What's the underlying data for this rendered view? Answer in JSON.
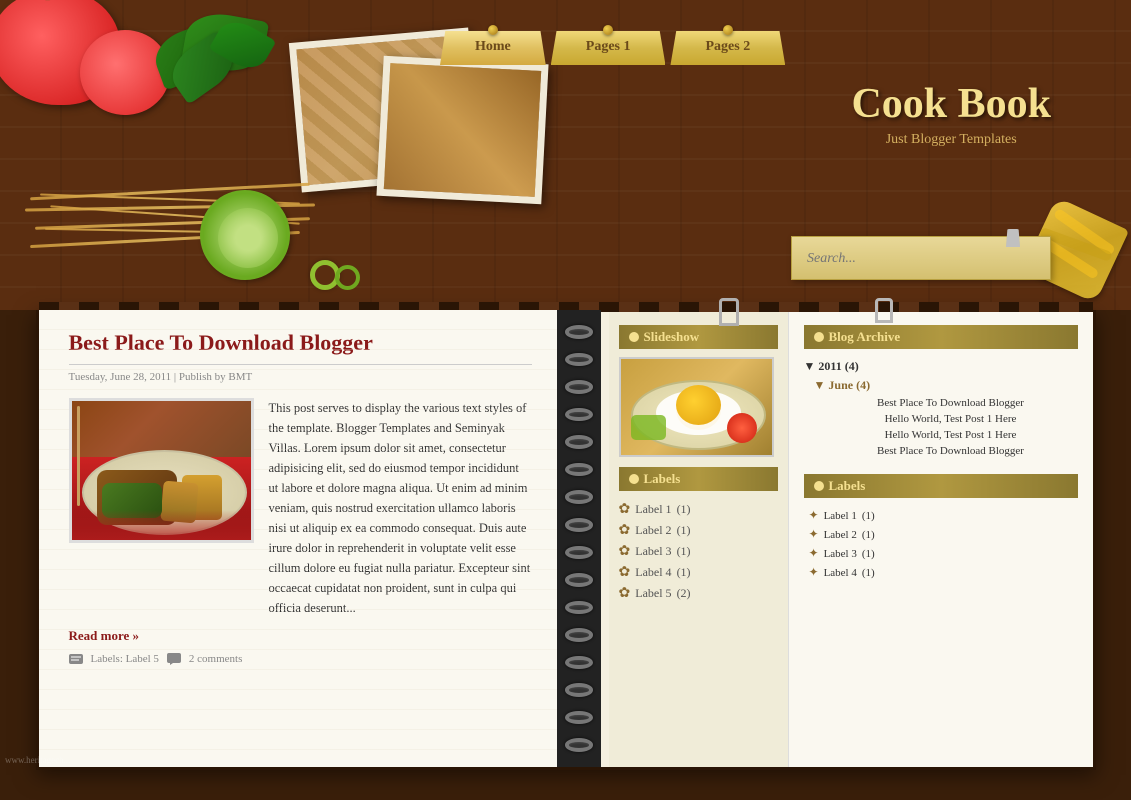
{
  "site": {
    "title": "Cook Book",
    "subtitle": "Just Blogger Templates",
    "watermark": "www.heritagech..."
  },
  "nav": {
    "tabs": [
      {
        "id": "home",
        "label": "Home",
        "active": true
      },
      {
        "id": "pages1",
        "label": "Pages 1",
        "active": false
      },
      {
        "id": "pages2",
        "label": "Pages 2",
        "active": false
      }
    ]
  },
  "search": {
    "placeholder": "Search..."
  },
  "post": {
    "title": "Best Place To Download Blogger",
    "meta": "Tuesday, June 28, 2011 | Publish by BMT",
    "body": "This post serves to display the various text styles of the template. Blogger Templates and Seminyak Villas. Lorem ipsum dolor sit amet, consectetur adipisicing elit, sed do eiusmod tempor incididunt ut labore et dolore magna aliqua. Ut enim ad minim veniam, quis nostrud exercitation ullamco laboris nisi ut aliquip ex ea commodo consequat. Duis aute irure dolor in reprehenderit in voluptate velit esse cillum dolore eu fugiat nulla pariatur. Excepteur sint occaecat cupidatat non proident, sunt in culpa qui officia deserunt...",
    "read_more": "Read more »",
    "footer_labels": "Labels: Label 5",
    "footer_comments": "2 comments"
  },
  "slideshow": {
    "title": "Slideshow"
  },
  "labels_middle": {
    "title": "Labels",
    "items": [
      {
        "name": "Label 1",
        "count": "(1)"
      },
      {
        "name": "Label 2",
        "count": "(1)"
      },
      {
        "name": "Label 3",
        "count": "(1)"
      },
      {
        "name": "Label 4",
        "count": "(1)"
      },
      {
        "name": "Label 5",
        "count": "(2)"
      }
    ]
  },
  "blog_archive": {
    "title": "Blog Archive",
    "years": [
      {
        "year": "2011",
        "count": "(4)",
        "months": [
          {
            "month": "June",
            "count": "(4)",
            "posts": [
              "Best Place To Download Blogger",
              "Hello World, Test Post 1 Here",
              "Hello World, Test Post 1 Here",
              "Best Place To Download Blogger"
            ]
          }
        ]
      }
    ]
  },
  "labels_right": {
    "title": "Labels",
    "items": [
      {
        "name": "Label 1",
        "count": "(1)"
      },
      {
        "name": "Label 2",
        "count": "(1)"
      },
      {
        "name": "Label 3",
        "count": "(1)"
      },
      {
        "name": "Label 4",
        "count": "(1)"
      }
    ]
  }
}
